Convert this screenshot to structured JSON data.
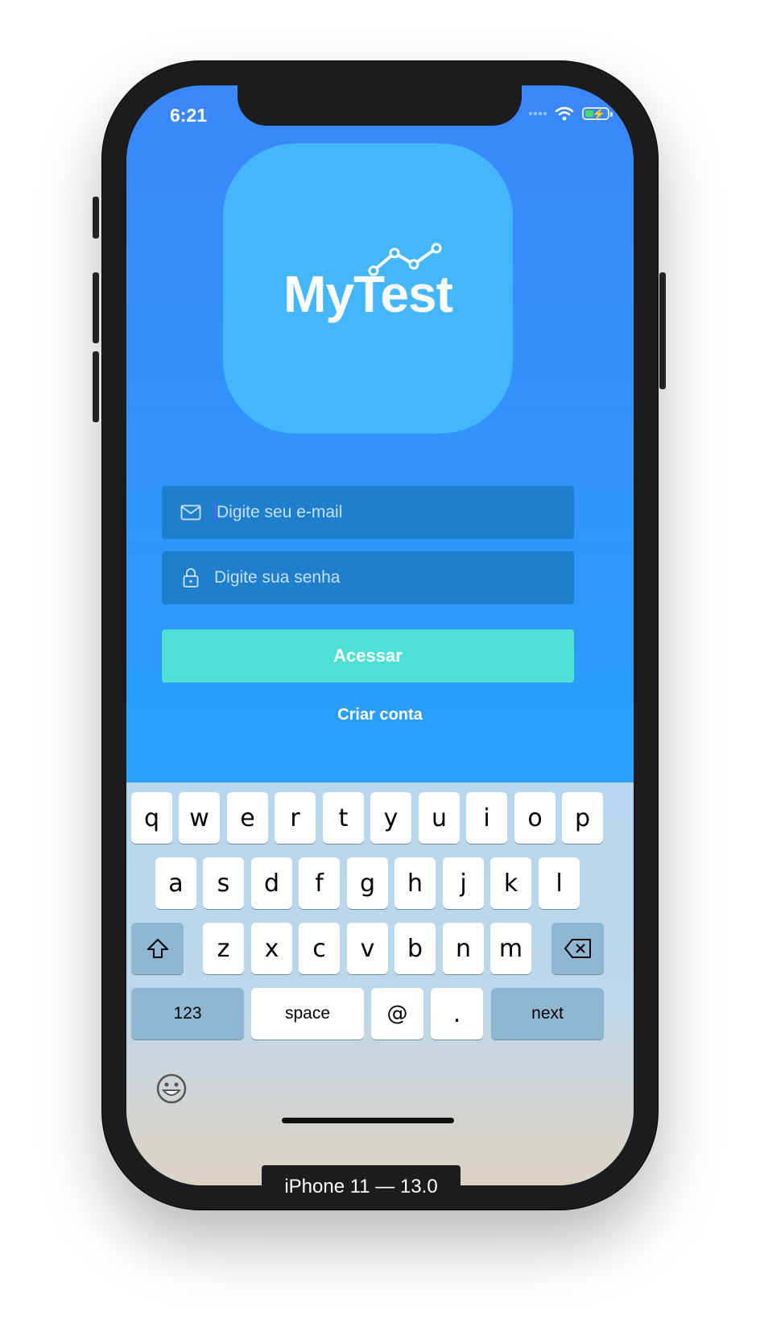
{
  "status_bar": {
    "time": "6:21"
  },
  "app": {
    "logo_text": "MyTest",
    "email_placeholder": "Digite seu e-mail",
    "password_placeholder": "Digite sua senha",
    "login_button": "Acessar",
    "create_account_link": "Criar conta"
  },
  "keyboard": {
    "row1": [
      "q",
      "w",
      "e",
      "r",
      "t",
      "y",
      "u",
      "i",
      "o",
      "p"
    ],
    "row2": [
      "a",
      "s",
      "d",
      "f",
      "g",
      "h",
      "j",
      "k",
      "l"
    ],
    "row3": [
      "z",
      "x",
      "c",
      "v",
      "b",
      "n",
      "m"
    ],
    "numbers_key": "123",
    "space_key": "space",
    "at_key": "@",
    "dot_key": ".",
    "next_key": "next"
  },
  "simulator": {
    "device_label": "iPhone 11 — 13.0"
  },
  "colors": {
    "background_top": "#3a87fb",
    "background_bottom": "#27a7fb",
    "logo_tile": "#43b6fc",
    "input_bg": "#1f7fcc",
    "primary_button": "#4ee0d4"
  },
  "icons": [
    "wifi-icon",
    "battery-icon",
    "mail-icon",
    "lock-icon",
    "shift-icon",
    "backspace-icon",
    "emoji-icon"
  ]
}
